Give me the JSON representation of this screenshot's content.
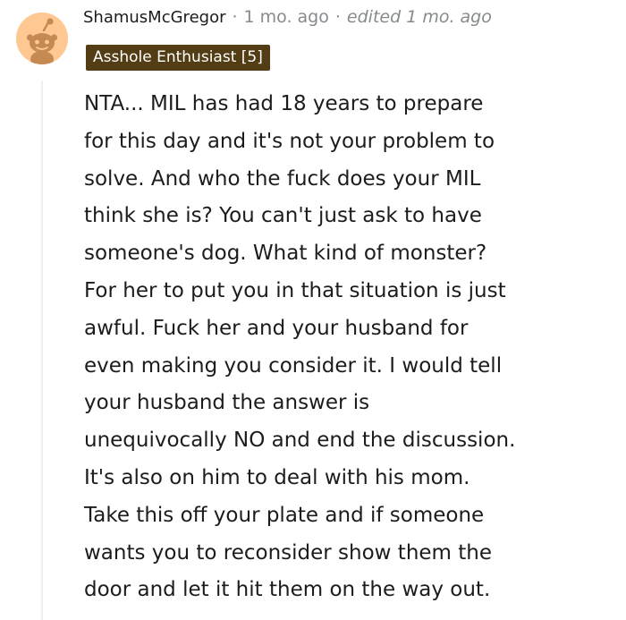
{
  "comment": {
    "author": "ShamusMcGregor",
    "separator": "·",
    "time": "1 mo. ago",
    "edited": "edited 1 mo. ago",
    "flair": "Asshole Enthusiast [5]",
    "body_lines": [
      "NTA... MIL has had 18 years to prepare",
      "for this day and it's not your problem to",
      "solve. And who the fuck does your MIL",
      "think she is? You can't just ask to have",
      "someone's dog. What kind of monster?",
      "For her to put you in that situation is just",
      "awful. Fuck her and your husband for",
      "even making you consider it. I would tell",
      "your husband the answer is",
      "unequivocally NO and end the discussion.",
      "It's also on him to deal with his mom.",
      "Take this off your plate and if someone",
      "wants you to reconsider show them the",
      "door and let it hit them on the way out."
    ]
  },
  "avatar": {
    "icon": "snoo-avatar-icon",
    "background_color": "#ffc893",
    "figure_color": "#c58a52"
  },
  "colors": {
    "flair_background": "#533d15",
    "flair_text": "#ffffff",
    "meta_text": "#878a8c",
    "body_text": "#1c1c1c",
    "thread_line": "#edeff1"
  }
}
